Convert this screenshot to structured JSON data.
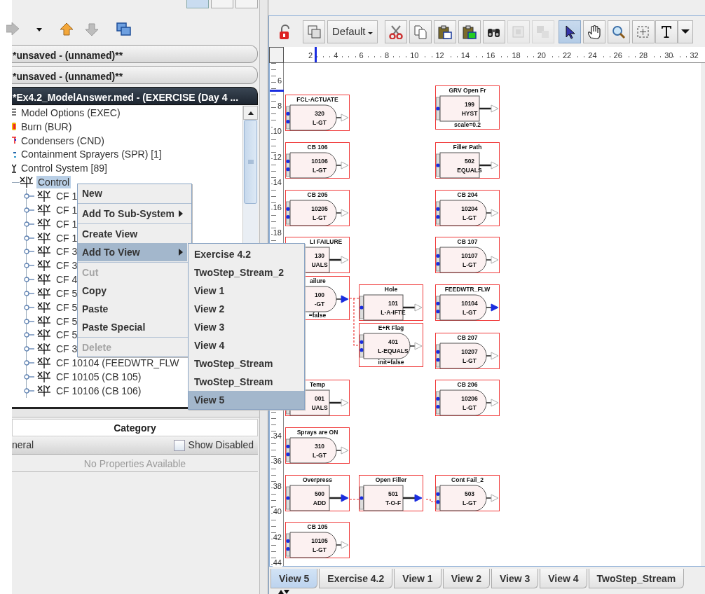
{
  "top_toggles": [
    {
      "selected": true
    },
    {
      "selected": false
    },
    {
      "selected": false
    }
  ],
  "nav_buttons": [
    {
      "kind": "forward",
      "disabled": true
    },
    {
      "kind": "caret",
      "disabled": false
    },
    {
      "kind": "up",
      "disabled": false
    },
    {
      "kind": "down",
      "disabled": true
    },
    {
      "kind": "windows",
      "disabled": false
    }
  ],
  "documents": [
    {
      "title": "*unsaved - (unnamed)**",
      "selected": false
    },
    {
      "title": "*unsaved - (unnamed)**",
      "selected": false
    },
    {
      "title": "*Ex4.2_ModelAnswer.med - (EXERCISE (Day 4 ...",
      "selected": true
    }
  ],
  "tree": {
    "items": [
      {
        "label": "Model Options (EXEC)",
        "kind": "options",
        "selected": false
      },
      {
        "label": "Burn (BUR)",
        "kind": "burn",
        "selected": false
      },
      {
        "label": "Condensers (CND)",
        "kind": "condenser",
        "selected": false
      },
      {
        "label": "Containment Sprayers (SPR) [1]",
        "kind": "sprayer",
        "selected": false
      },
      {
        "label": "Control System [89]",
        "kind": "control",
        "selected": false,
        "children": [
          {
            "label": "Control",
            "kind": "function",
            "selected": true,
            "children": [
              {
                "label": "CF 1",
                "kind": "function",
                "selected": false
              },
              {
                "label": "CF 1",
                "kind": "function",
                "selected": false
              },
              {
                "label": "CF 1",
                "kind": "function",
                "selected": false
              },
              {
                "label": "CF 1",
                "kind": "function",
                "selected": false
              },
              {
                "label": "CF 3",
                "kind": "function",
                "selected": false
              },
              {
                "label": "CF 3",
                "kind": "function",
                "selected": false
              },
              {
                "label": "CF 4",
                "kind": "function",
                "selected": false
              },
              {
                "label": "CF 5",
                "kind": "function",
                "selected": false
              },
              {
                "label": "CF 5",
                "kind": "function",
                "selected": false
              },
              {
                "label": "CF 5",
                "kind": "function",
                "selected": false
              },
              {
                "label": "CF 5",
                "kind": "function",
                "selected": false
              },
              {
                "label": "CF 3",
                "kind": "function",
                "selected": false
              },
              {
                "label": "CF 10104 (FEEDWTR_FLW",
                "kind": "function",
                "selected": false
              },
              {
                "label": "CF 10105 (CB 105)",
                "kind": "function",
                "selected": false
              },
              {
                "label": "CF 10106 (CB 106)",
                "kind": "function",
                "selected": false
              }
            ]
          }
        ]
      }
    ]
  },
  "properties": {
    "header": "Category",
    "group": "neral",
    "show_disabled": {
      "label": "Show Disabled",
      "checked": false
    },
    "message": "No Properties Available"
  },
  "context_menu": {
    "items": [
      {
        "kind": "item",
        "label": "New",
        "disabled": false,
        "selected": false,
        "submenu": false
      },
      {
        "kind": "separator"
      },
      {
        "kind": "item",
        "label": "Add To Sub-System",
        "disabled": false,
        "selected": false,
        "submenu": true
      },
      {
        "kind": "separator"
      },
      {
        "kind": "item",
        "label": "Create View",
        "disabled": false,
        "selected": false,
        "submenu": false
      },
      {
        "kind": "item",
        "label": "Add To View",
        "disabled": false,
        "selected": true,
        "submenu": true
      },
      {
        "kind": "separator"
      },
      {
        "kind": "item",
        "label": "Cut",
        "disabled": true,
        "selected": false,
        "submenu": false
      },
      {
        "kind": "item",
        "label": "Copy",
        "disabled": false,
        "selected": false,
        "submenu": false
      },
      {
        "kind": "item",
        "label": "Paste",
        "disabled": false,
        "selected": false,
        "submenu": false
      },
      {
        "kind": "item",
        "label": "Paste Special",
        "disabled": false,
        "selected": false,
        "submenu": false
      },
      {
        "kind": "separator"
      },
      {
        "kind": "item",
        "label": "Delete",
        "disabled": true,
        "selected": false,
        "submenu": false
      }
    ],
    "submenu": [
      {
        "label": "Exercise 4.2",
        "selected": false
      },
      {
        "label": "TwoStep_Stream_2",
        "selected": false
      },
      {
        "label": "View 1",
        "selected": false
      },
      {
        "label": "View 2",
        "selected": false
      },
      {
        "label": "View 3",
        "selected": false
      },
      {
        "label": "View 4",
        "selected": false
      },
      {
        "label": "TwoStep_Stream",
        "selected": false
      },
      {
        "label": "TwoStep_Stream",
        "selected": false
      },
      {
        "label": "View 5",
        "selected": true
      }
    ]
  },
  "editor_toolbar": {
    "style_dropdown": "Default",
    "tools": [
      {
        "kind": "lock",
        "disabled": false,
        "selected": false
      },
      {
        "kind": "layers",
        "disabled": false,
        "selected": false
      },
      {
        "kind": "cut",
        "disabled": false,
        "selected": false
      },
      {
        "kind": "copy",
        "disabled": false,
        "selected": false
      },
      {
        "kind": "paste",
        "disabled": false,
        "selected": false
      },
      {
        "kind": "paste-special",
        "disabled": false,
        "selected": false
      },
      {
        "kind": "find",
        "disabled": false,
        "selected": false
      },
      {
        "kind": "group",
        "disabled": true,
        "selected": false
      },
      {
        "kind": "ungroup",
        "disabled": true,
        "selected": false
      },
      {
        "kind": "pointer",
        "disabled": false,
        "selected": true
      },
      {
        "kind": "pan",
        "disabled": false,
        "selected": false
      },
      {
        "kind": "zoom",
        "disabled": false,
        "selected": false
      },
      {
        "kind": "marquee",
        "disabled": false,
        "selected": false
      },
      {
        "kind": "text",
        "disabled": false,
        "selected": false
      },
      {
        "kind": "more",
        "disabled": false,
        "selected": false
      }
    ]
  },
  "ruler": {
    "x_labels": [
      "2",
      "4",
      "6",
      "8",
      "10",
      "12",
      "14",
      "16",
      "18",
      "20",
      "22",
      "24",
      "26",
      "28",
      "30",
      "32"
    ],
    "y_labels": [
      "6",
      "8",
      "10",
      "12",
      "14",
      "16",
      "18",
      "34",
      "36",
      "38",
      "40",
      "42",
      "44"
    ]
  },
  "nodes": [
    {
      "title": "FCL-ACTUATE",
      "number": "320",
      "type": "L-GT",
      "kind": "gate",
      "output_connected": false
    },
    {
      "title": "CB 106",
      "number": "10106",
      "type": "L-GT",
      "kind": "gate",
      "output_connected": false
    },
    {
      "title": "CB 205",
      "number": "10205",
      "type": "L-GT",
      "kind": "gate",
      "output_connected": false
    },
    {
      "title": "LI FAILURE",
      "number": "130",
      "type": "UALS",
      "kind": "block",
      "output_connected": false
    },
    {
      "title": "ailure",
      "number": "100",
      "type": "-GT",
      "note": "=false",
      "kind": "gate",
      "output_connected": true
    },
    {
      "title": "Temp",
      "number": "001",
      "type": "UALS",
      "kind": "block",
      "output_connected": false
    },
    {
      "title": "Sprays are ON",
      "number": "310",
      "type": "L-GT",
      "kind": "gate",
      "output_connected": false
    },
    {
      "title": "Overpress",
      "number": "500",
      "type": "ADD",
      "kind": "block",
      "output_connected": true
    },
    {
      "title": "CB 105",
      "number": "10105",
      "type": "L-GT",
      "kind": "gate",
      "output_connected": false
    },
    {
      "title": "Hole",
      "number": "101",
      "type": "L-A-IFTE",
      "kind": "block",
      "output_connected": false
    },
    {
      "title": "E+R Flag",
      "number": "401",
      "type": "L-EQUALS",
      "note": "init=false",
      "kind": "gate",
      "output_connected": false
    },
    {
      "title": "Open Filler",
      "number": "501",
      "type": "T-O-F",
      "kind": "block",
      "output_connected": true
    },
    {
      "title": "GRV Open Fr",
      "number": "199",
      "type": "HYST",
      "note": "scale=0.2",
      "kind": "block",
      "output_connected": false
    },
    {
      "title": "Filler Path",
      "number": "502",
      "type": "EQUALS",
      "kind": "block",
      "output_connected": false
    },
    {
      "title": "CB 204",
      "number": "10204",
      "type": "L-GT",
      "kind": "gate",
      "output_connected": false
    },
    {
      "title": "CB 107",
      "number": "10107",
      "type": "L-GT",
      "kind": "gate",
      "output_connected": false
    },
    {
      "title": "FEEDWTR_FLW",
      "number": "10104",
      "type": "L-GT",
      "kind": "gate",
      "output_connected": true
    },
    {
      "title": "CB 207",
      "number": "10207",
      "type": "L-GT",
      "kind": "gate",
      "output_connected": false
    },
    {
      "title": "CB 206",
      "number": "10206",
      "type": "L-GT",
      "kind": "gate",
      "output_connected": false
    },
    {
      "title": "Cont Fail_2",
      "number": "503",
      "type": "L-GT",
      "kind": "gate",
      "output_connected": false
    }
  ],
  "view_tabs": [
    {
      "label": "View 5",
      "selected": true
    },
    {
      "label": "Exercise 4.2",
      "selected": false
    },
    {
      "label": "View 1",
      "selected": false
    },
    {
      "label": "View 2",
      "selected": false
    },
    {
      "label": "View 3",
      "selected": false
    },
    {
      "label": "View 4",
      "selected": false
    },
    {
      "label": "TwoStep_Stream",
      "selected": false
    }
  ]
}
